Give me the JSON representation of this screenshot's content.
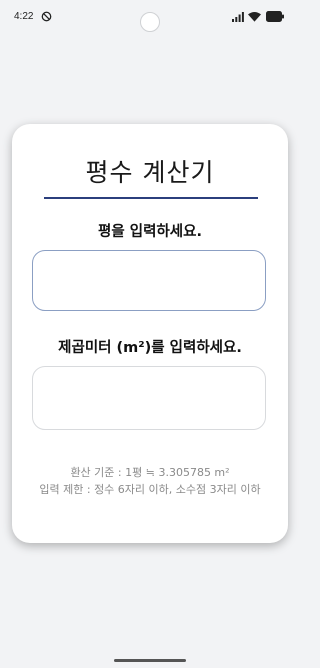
{
  "status_bar": {
    "time": "4:22",
    "icons": [
      "do-not-disturb-icon",
      "signal-icon",
      "wifi-icon",
      "battery-icon"
    ]
  },
  "app": {
    "title": "평수 계산기",
    "pyeong_label": "평을 입력하세요.",
    "pyeong_value": "",
    "pyeong_placeholder": "",
    "m2_label": "제곱미터 (m²)를 입력하세요.",
    "m2_value": "",
    "m2_placeholder": "",
    "conversion_info": "환산 기준 : 1평 ≒ 3.305785 m²",
    "limit_info": "입력 제한 : 정수 6자리 이하, 소수점 3자리 이하"
  },
  "colors": {
    "background": "#f2f3f5",
    "accent": "#2b3f7d",
    "focused_input_border": "#8b9fc3",
    "muted_text": "#8a8a8a"
  }
}
